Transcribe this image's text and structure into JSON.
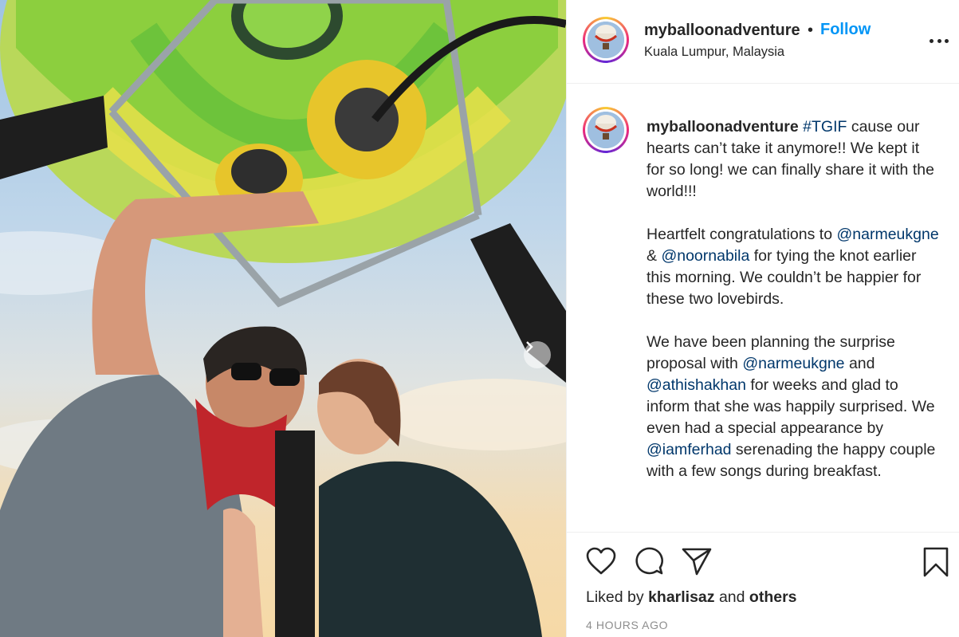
{
  "post": {
    "username": "myballoonadventure",
    "separator": "•",
    "follow_label": "Follow",
    "location": "Kuala Lumpur, Malaysia",
    "caption": {
      "username": "myballoonadventure",
      "segments": [
        {
          "type": "tag",
          "text": "#TGIF"
        },
        {
          "type": "text",
          "text": " cause our hearts can’t take it anymore!! We kept it for so long! we can finally share it with the world!!!\n\nHeartfelt congratulations to "
        },
        {
          "type": "tag",
          "text": "@narmeukgne"
        },
        {
          "type": "text",
          "text": " & "
        },
        {
          "type": "tag",
          "text": "@noornabila"
        },
        {
          "type": "text",
          "text": " for tying the knot earlier this morning. We couldn’t be happier for these two lovebirds.\n\nWe have been planning the surprise proposal with "
        },
        {
          "type": "tag",
          "text": "@narmeukgne"
        },
        {
          "type": "text",
          "text": " and "
        },
        {
          "type": "tag",
          "text": "@athishakhan"
        },
        {
          "type": "text",
          "text": " for weeks and glad to inform that she was happily surprised. We even had a special appearance by "
        },
        {
          "type": "tag",
          "text": "@iamferhad"
        },
        {
          "type": "text",
          "text": " serenading the happy couple with a few songs during breakfast."
        }
      ]
    },
    "likes": {
      "prefix": "Liked by",
      "user": "kharlisaz",
      "joiner": "and",
      "others": "others"
    },
    "timestamp": "4 HOURS AGO"
  },
  "icons": {
    "like": "heart-icon",
    "comment": "comment-icon",
    "share": "paper-plane-icon",
    "save": "bookmark-icon",
    "more": "more-options-icon",
    "next": "chevron-right-icon"
  },
  "colors": {
    "follow": "#0095f6",
    "mention": "#00376b",
    "muted": "#8e8e8e",
    "text": "#262626"
  }
}
